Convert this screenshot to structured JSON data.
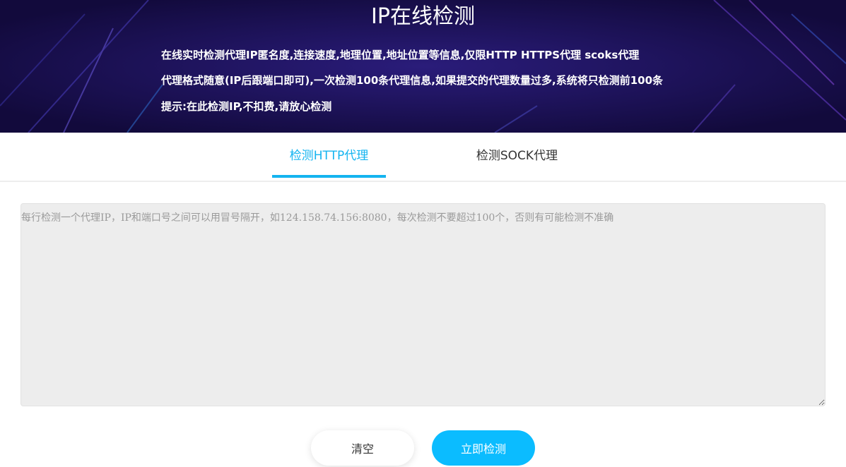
{
  "banner": {
    "title": "IP在线检测",
    "lines": [
      "在线实时检测代理IP匿名度,连接速度,地理位置,地址位置等信息,仅限HTTP HTTPS代理 scoks代理",
      "代理格式随意(IP后跟端口即可),一次检测100条代理信息,如果提交的代理数量过多,系统将只检测前100条",
      "提示:在此检测IP,不扣费,请放心检测"
    ]
  },
  "tabs": [
    {
      "label": "检测HTTP代理",
      "active": true
    },
    {
      "label": "检测SOCK代理",
      "active": false
    }
  ],
  "input": {
    "value": "",
    "placeholder": "每行检测一个代理IP，IP和端口号之间可以用冒号隔开，如124.158.74.156:8080，每次检测不要超过100个，否则有可能检测不准确"
  },
  "buttons": {
    "clear_label": "清空",
    "check_label": "立即检测"
  },
  "colors": {
    "banner_bg": "#1a0f52",
    "accent": "#14b4f0",
    "primary_button": "#0bbcff",
    "input_bg": "#ededed"
  }
}
